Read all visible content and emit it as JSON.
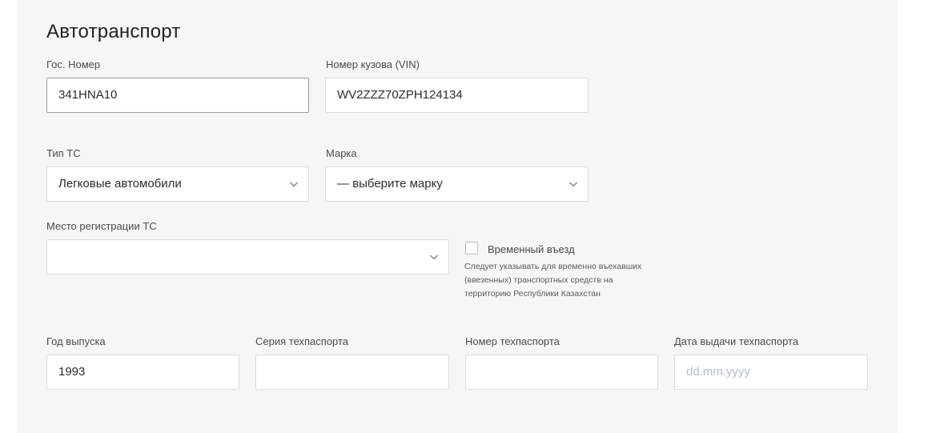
{
  "section": {
    "title": "Автотранспорт"
  },
  "fields": {
    "plate": {
      "label": "Гос. Номер",
      "value": "341HNA10"
    },
    "vin": {
      "label": "Номер кузова (VIN)",
      "value": "WV2ZZZ70ZPH124134"
    },
    "vehicle_type": {
      "label": "Тип ТС",
      "value": "Легковые автомобили"
    },
    "brand": {
      "label": "Марка",
      "value": "— выберите марку"
    },
    "registration_place": {
      "label": "Место регистрации ТС",
      "value": ""
    },
    "temporary_entry": {
      "label": "Временный въезд",
      "checked": false,
      "hint": "Следует указывать для временно въехавших (ввезенных) транспортных средств на территорию Республики Казахстан"
    },
    "year": {
      "label": "Год выпуска",
      "value": "1993"
    },
    "passport_series": {
      "label": "Серия техпаспорта",
      "value": ""
    },
    "passport_number": {
      "label": "Номер техпаспорта",
      "value": ""
    },
    "passport_date": {
      "label": "Дата выдачи техпаспорта",
      "placeholder": "dd.mm.yyyy",
      "value": ""
    }
  },
  "icons": {
    "dropdown": "chevron-down-icon"
  },
  "colors": {
    "panel_bg": "#f6f6f6",
    "field_border": "#dcdcdc",
    "focused_border": "#9a9a9a",
    "placeholder": "#b7bcc3"
  }
}
